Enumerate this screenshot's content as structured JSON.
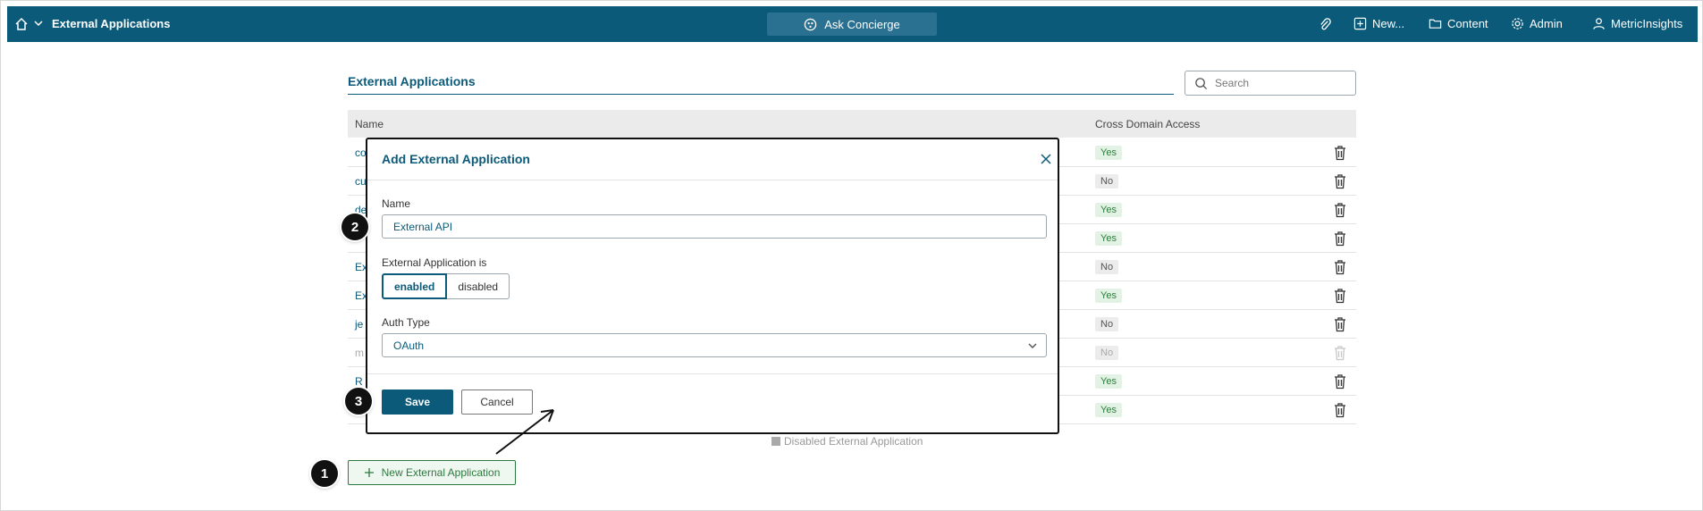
{
  "topbar": {
    "title": "External Applications",
    "concierge": "Ask Concierge",
    "nav": {
      "new": "New...",
      "content": "Content",
      "admin": "Admin",
      "user": "MetricInsights"
    }
  },
  "page": {
    "section_title": "External Applications",
    "search_placeholder": "Search",
    "columns": {
      "name": "Name",
      "cross_domain": "Cross Domain Access"
    },
    "rows": [
      {
        "name": "co",
        "access": "Yes",
        "disabled": false
      },
      {
        "name": "cu",
        "access": "No",
        "disabled": false
      },
      {
        "name": "de",
        "access": "Yes",
        "disabled": false
      },
      {
        "name": "",
        "access": "Yes",
        "disabled": false
      },
      {
        "name": "Ex",
        "access": "No",
        "disabled": false
      },
      {
        "name": "Ex",
        "access": "Yes",
        "disabled": false
      },
      {
        "name": "je",
        "access": "No",
        "disabled": false
      },
      {
        "name": "m",
        "access": "No",
        "disabled": true
      },
      {
        "name": "R",
        "access": "Yes",
        "disabled": false
      },
      {
        "name": "",
        "access": "Yes",
        "disabled": false
      }
    ],
    "legend": "Disabled External Application",
    "new_button": "New External Application"
  },
  "modal": {
    "title": "Add External Application",
    "name_label": "Name",
    "name_value": "External API",
    "status_label": "External Application is",
    "status_enabled": "enabled",
    "status_disabled": "disabled",
    "auth_label": "Auth Type",
    "auth_value": "OAuth",
    "save": "Save",
    "cancel": "Cancel"
  },
  "steps": [
    "1",
    "2",
    "3"
  ],
  "colors": {
    "brand": "#0b5a7a",
    "yes": "#2d7a3e"
  }
}
